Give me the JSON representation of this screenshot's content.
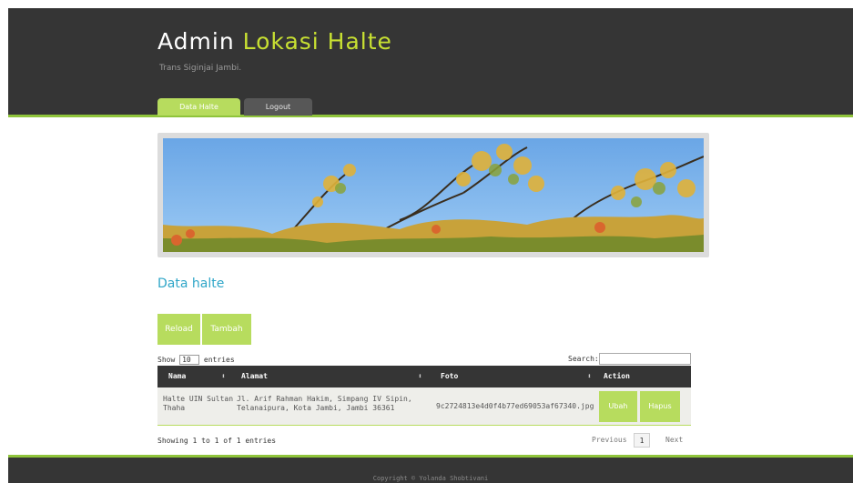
{
  "header": {
    "title_main": "Admin ",
    "title_accent": "Lokasi Halte",
    "subtitle": "Trans Siginjai Jambi.",
    "tabs": [
      {
        "label": "Data Halte",
        "active": true
      },
      {
        "label": "Logout",
        "active": false
      }
    ]
  },
  "banner": {
    "alt": "tree-branches-banner"
  },
  "section": {
    "title": "Data halte"
  },
  "toolbar": {
    "reload_label": "Reload",
    "tambah_label": "Tambah"
  },
  "table_controls": {
    "show_label": "Show",
    "entries_value": "10",
    "entries_label": "entries",
    "search_label": "Search:",
    "search_value": ""
  },
  "table": {
    "columns": [
      "Nama",
      "Alamat",
      "Foto",
      "Action"
    ],
    "rows": [
      {
        "nama_line1": "Halte UIN Sultan",
        "nama_line2": "Thaha",
        "alamat_line1": "Jl. Arif Rahman Hakim, Simpang IV Sipin,",
        "alamat_line2": "Telanaipura, Kota Jambi, Jambi 36361",
        "foto": "9c2724813e4d0f4b77ed69053af67340.jpg",
        "ubah_label": "Ubah",
        "hapus_label": "Hapus"
      }
    ]
  },
  "pagination": {
    "info": "Showing 1 to 1 of 1 entries",
    "previous": "Previous",
    "current_page": "1",
    "next": "Next"
  },
  "footer": {
    "text": "Copyright © Yolanda Shobtivani"
  },
  "colors": {
    "accent_green": "#b7dc5e",
    "dark": "#353535",
    "title_accent": "#c8e032",
    "section_title": "#2fa6c8"
  }
}
